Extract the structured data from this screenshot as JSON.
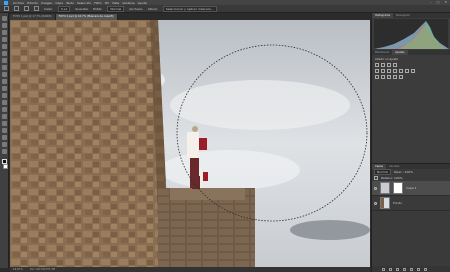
{
  "menu": {
    "items": [
      "Archivo",
      "Edición",
      "Imagen",
      "Capa",
      "Texto",
      "Selección",
      "Filtro",
      "3D",
      "Vista",
      "Ventana",
      "Ayuda"
    ],
    "window_controls": [
      "–",
      "□",
      "✕"
    ]
  },
  "options": {
    "feather_label": "Calar:",
    "feather_value": "0 px",
    "antialias_label": "Suavizar",
    "style_label": "Estilo:",
    "style_value": "Normal",
    "width_label": "Anchura:",
    "height_label": "Altura:",
    "refine_label": "Seleccionar y aplicar máscara..."
  },
  "document_tabs": [
    {
      "label": "FOTO 1.psd @ 17,7% (RGB/8)",
      "active": false
    },
    {
      "label": "FOTO 2.psd @ 16,7% (Máscara de capa/8)",
      "active": true
    }
  ],
  "status": {
    "zoom": "16,67%",
    "doc_info": "Doc: 68,7M/137,3M"
  },
  "panels": {
    "top_tabs": [
      "Histograma",
      "Navegador"
    ],
    "mid_tabs": [
      "Bibliotecas",
      "Ajustes"
    ],
    "adjust_title": "Añadir un ajuste",
    "layer_tabs": [
      "Capas",
      "Canales"
    ],
    "blend_mode": "Normal",
    "opacity_label": "Opac.: 100%",
    "fill_label": "Relleno: 100%",
    "layers": [
      {
        "name": "Capa 1",
        "selected": true
      },
      {
        "name": "Fondo",
        "selected": false
      }
    ]
  },
  "colors": {
    "accent": "#31a8ff",
    "panel_bg": "#3c3c3c",
    "app_bg": "#2b2b2b"
  }
}
